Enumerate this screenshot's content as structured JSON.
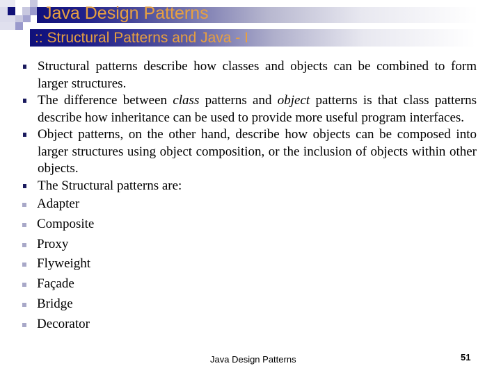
{
  "header": {
    "title": "Java Design Patterns",
    "subtitle": ":: Structural Patterns and Java - I",
    "title_color": "#e8a040",
    "bar_color": "#10107a"
  },
  "body": {
    "bullets": [
      {
        "text": "Structural patterns describe how classes and objects can be combined to form larger structures."
      },
      {
        "pre": "The difference between ",
        "em1": "class",
        "mid": " patterns and ",
        "em2": "object",
        "post": " patterns is that class patterns describe how inheritance can be used to provide more useful program interfaces."
      },
      {
        "text": "Object patterns, on the other hand, describe how objects can be composed into larger structures using object composition, or the inclusion of objects within other objects."
      },
      {
        "text": "The Structural patterns are:"
      }
    ],
    "patterns": [
      "Adapter",
      "Composite",
      "Proxy",
      "Flyweight",
      "Façade",
      "Bridge",
      "Decorator"
    ]
  },
  "footer": {
    "text": "Java Design Patterns",
    "page_number": "51"
  }
}
